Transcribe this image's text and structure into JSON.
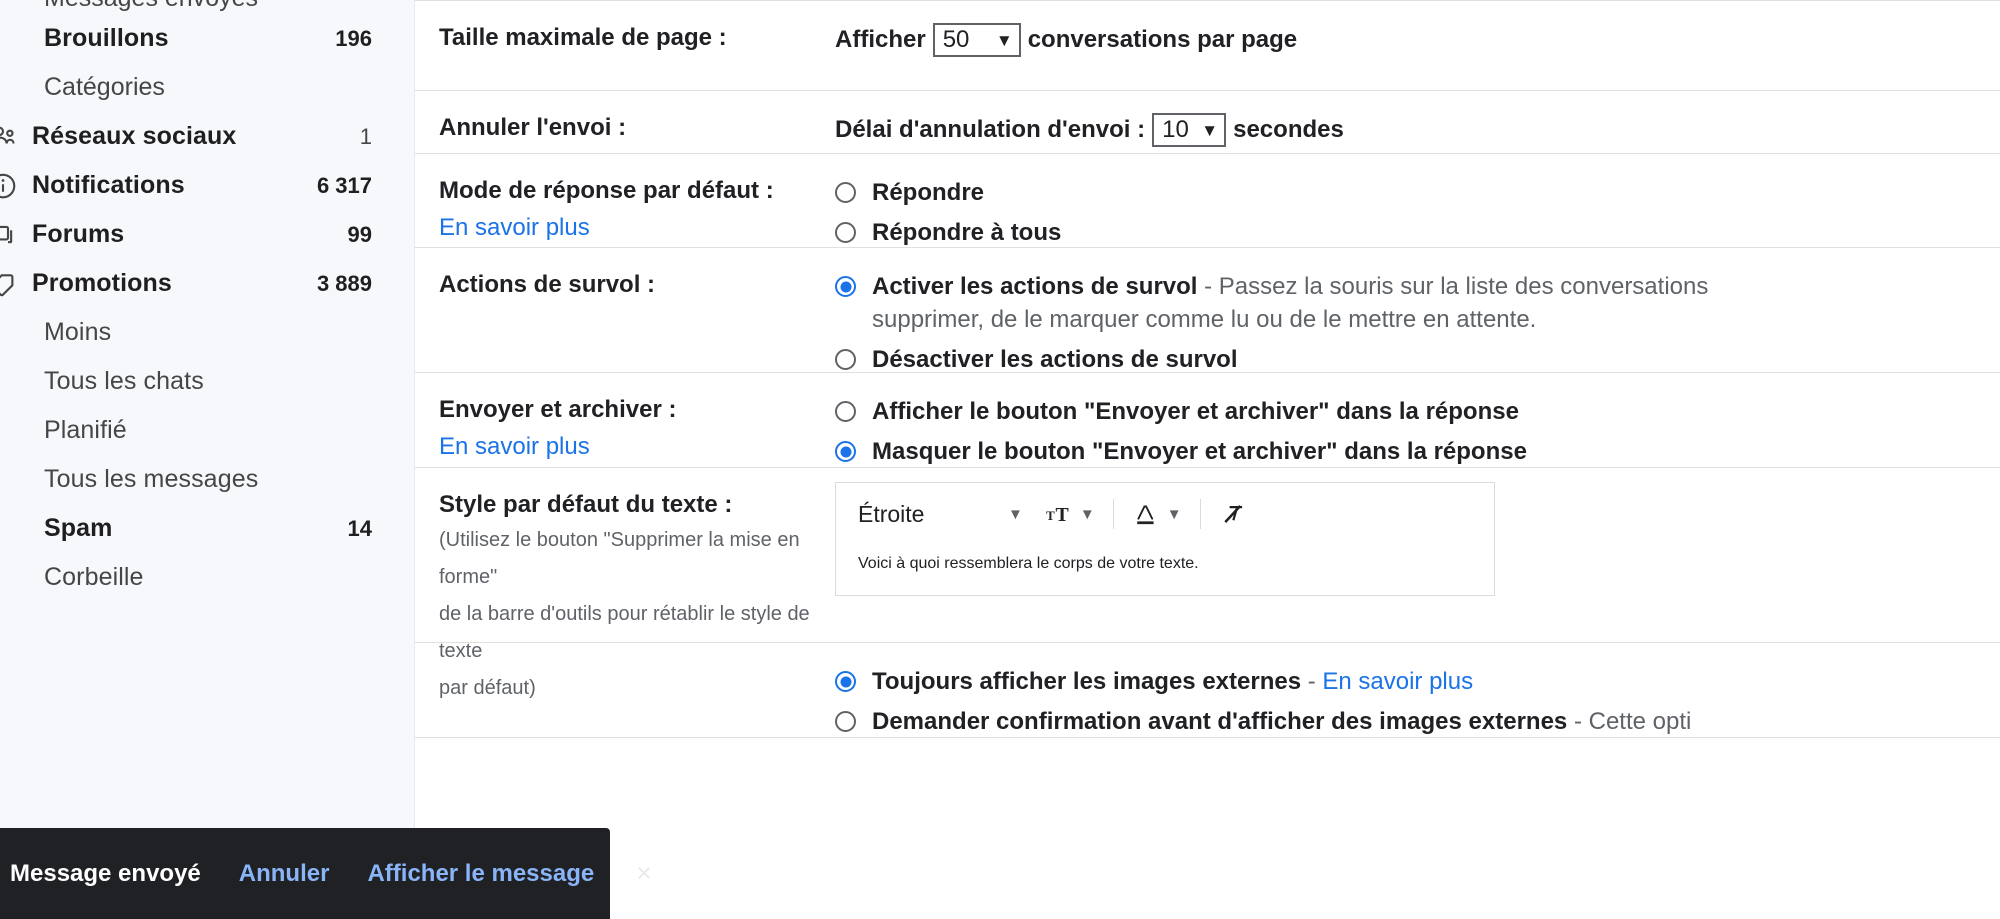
{
  "sidebar": {
    "cut_off_top_item": "Messages envoyés",
    "items": [
      {
        "label": "Brouillons",
        "count": "196",
        "icon": "",
        "bold": true,
        "indent": true
      },
      {
        "label": "Catégories",
        "count": "",
        "icon": "",
        "bold": false,
        "indent": true,
        "is_section": true
      },
      {
        "label": "Réseaux sociaux",
        "count": "1",
        "icon": "social-icon",
        "bold": true,
        "indent": false
      },
      {
        "label": "Notifications",
        "count": "6 317",
        "icon": "info-icon",
        "bold": true,
        "indent": false
      },
      {
        "label": "Forums",
        "count": "99",
        "icon": "forums-icon",
        "bold": true,
        "indent": false
      },
      {
        "label": "Promotions",
        "count": "3 889",
        "icon": "tag-icon",
        "bold": true,
        "indent": false
      },
      {
        "label": "Moins",
        "count": "",
        "icon": "",
        "bold": false,
        "indent": true
      },
      {
        "label": "Tous les chats",
        "count": "",
        "icon": "",
        "bold": false,
        "indent": true
      },
      {
        "label": "Planifié",
        "count": "",
        "icon": "",
        "bold": false,
        "indent": true
      },
      {
        "label": "Tous les messages",
        "count": "",
        "icon": "",
        "bold": false,
        "indent": true
      },
      {
        "label": "Spam",
        "count": "14",
        "icon": "",
        "bold": true,
        "indent": true
      },
      {
        "label": "Corbeille",
        "count": "",
        "icon": "",
        "bold": false,
        "indent": true
      }
    ]
  },
  "settings": {
    "rows": [
      {
        "id": "max-page-size",
        "label": "Taille maximale de page :",
        "link": "",
        "note": "",
        "type": "select-sentence",
        "prefix": "Afficher",
        "value": "50",
        "suffix": "conversations par page"
      },
      {
        "id": "undo-send",
        "label": "Annuler l'envoi :",
        "link": "",
        "note": "",
        "type": "select-sentence",
        "prefix": "Délai d'annulation d'envoi :",
        "value": "10",
        "suffix": "secondes"
      },
      {
        "id": "default-reply-mode",
        "label": "Mode de réponse par défaut :",
        "link": "En savoir plus",
        "note": "",
        "type": "radios",
        "options": [
          {
            "text": "Répondre",
            "checked": false
          },
          {
            "text": "Répondre à tous",
            "checked": false
          }
        ]
      },
      {
        "id": "hover-actions",
        "label": "Actions de survol :",
        "link": "",
        "note": "",
        "type": "radios",
        "options": [
          {
            "text": "Activer les actions de survol",
            "desc": " - Passez la souris sur la liste des conversations",
            "desc2": "supprimer, de le marquer comme lu ou de le mettre en attente.",
            "checked": true
          },
          {
            "text": "Désactiver les actions de survol",
            "checked": false
          }
        ]
      },
      {
        "id": "send-and-archive",
        "label": "Envoyer et archiver :",
        "link": "En savoir plus",
        "note": "",
        "type": "radios",
        "options": [
          {
            "text": "Afficher le bouton \"Envoyer et archiver\" dans la réponse",
            "checked": false
          },
          {
            "text": "Masquer le bouton \"Envoyer et archiver\" dans la réponse",
            "checked": true
          }
        ]
      },
      {
        "id": "default-text-style",
        "label": "Style par défaut du texte :",
        "link": "",
        "note_lines": [
          "(Utilisez le bouton \"Supprimer la mise en forme\"",
          "de la barre d'outils pour rétablir le style de texte",
          "par défaut)"
        ],
        "type": "text-style",
        "font_name": "Étroite",
        "sample_text": "Voici à quoi ressemblera le corps de votre texte."
      },
      {
        "id": "external-images",
        "label": "",
        "link": "",
        "note": "",
        "type": "radios",
        "options": [
          {
            "text": "Toujours afficher les images externes",
            "dash": " - ",
            "link": "En savoir plus",
            "checked": true
          },
          {
            "text": "Demander confirmation avant d'afficher des images externes",
            "dash": " - ",
            "desc": "Cette opti",
            "checked": false
          }
        ]
      }
    ]
  },
  "toast": {
    "message": "Message envoyé",
    "undo_label": "Annuler",
    "view_label": "Afficher le message",
    "close_icon": "×"
  },
  "colors": {
    "accent": "#1a73e8",
    "toast_bg": "#202124",
    "toast_link": "#8ab4f8",
    "sidebar_bg": "#f6f8fc",
    "text": "#202124",
    "muted": "#5f6368"
  },
  "toolbar_icons": {
    "font_caret": "chevron-down-icon",
    "size_icon": "font-size-icon",
    "size_caret": "chevron-down-icon",
    "color_icon": "text-color-icon",
    "color_caret": "chevron-down-icon",
    "clear_format_icon": "remove-formatting-icon"
  }
}
